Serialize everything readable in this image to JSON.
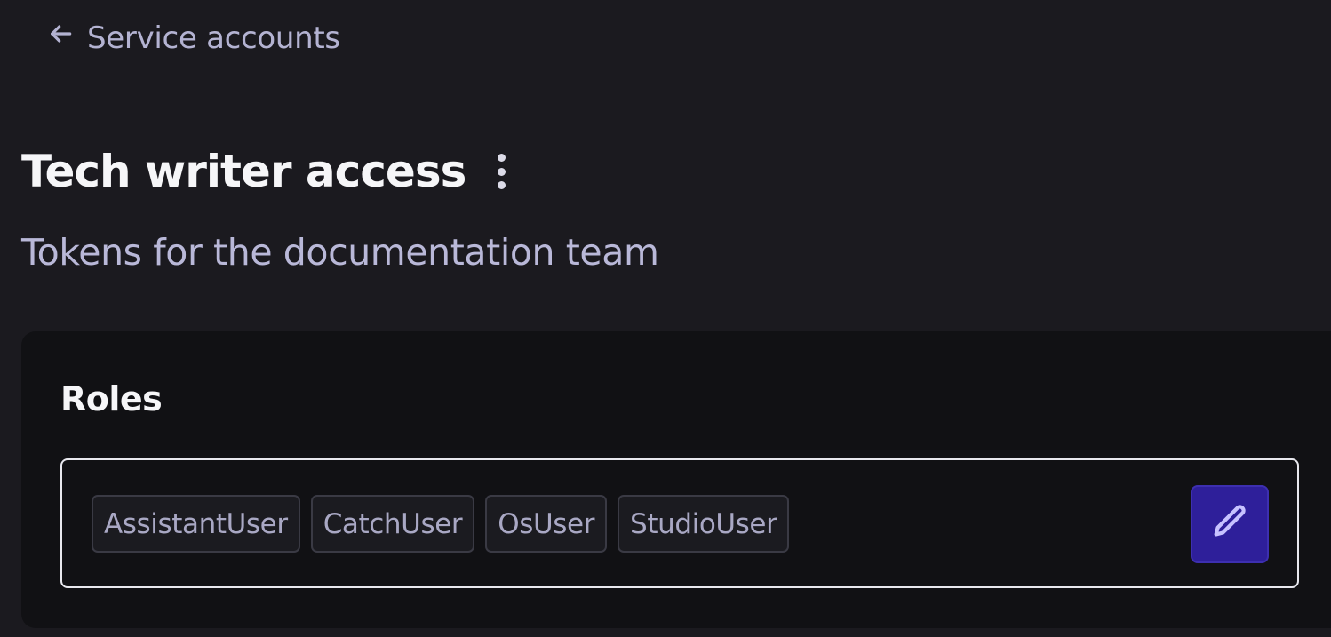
{
  "nav": {
    "back_label": "Service accounts"
  },
  "header": {
    "title": "Tech writer access",
    "subtitle": "Tokens for the documentation team"
  },
  "roles": {
    "heading": "Roles",
    "items": [
      "AssistantUser",
      "CatchUser",
      "OsUser",
      "StudioUser"
    ],
    "edit_icon": "pencil-icon"
  },
  "icons": {
    "back": "arrow-left-icon",
    "more": "kebab-menu-icon"
  },
  "colors": {
    "background": "#1b1a1f",
    "card": "#111114",
    "accent": "#2e1f9a",
    "muted_text": "#b4b3d2"
  }
}
